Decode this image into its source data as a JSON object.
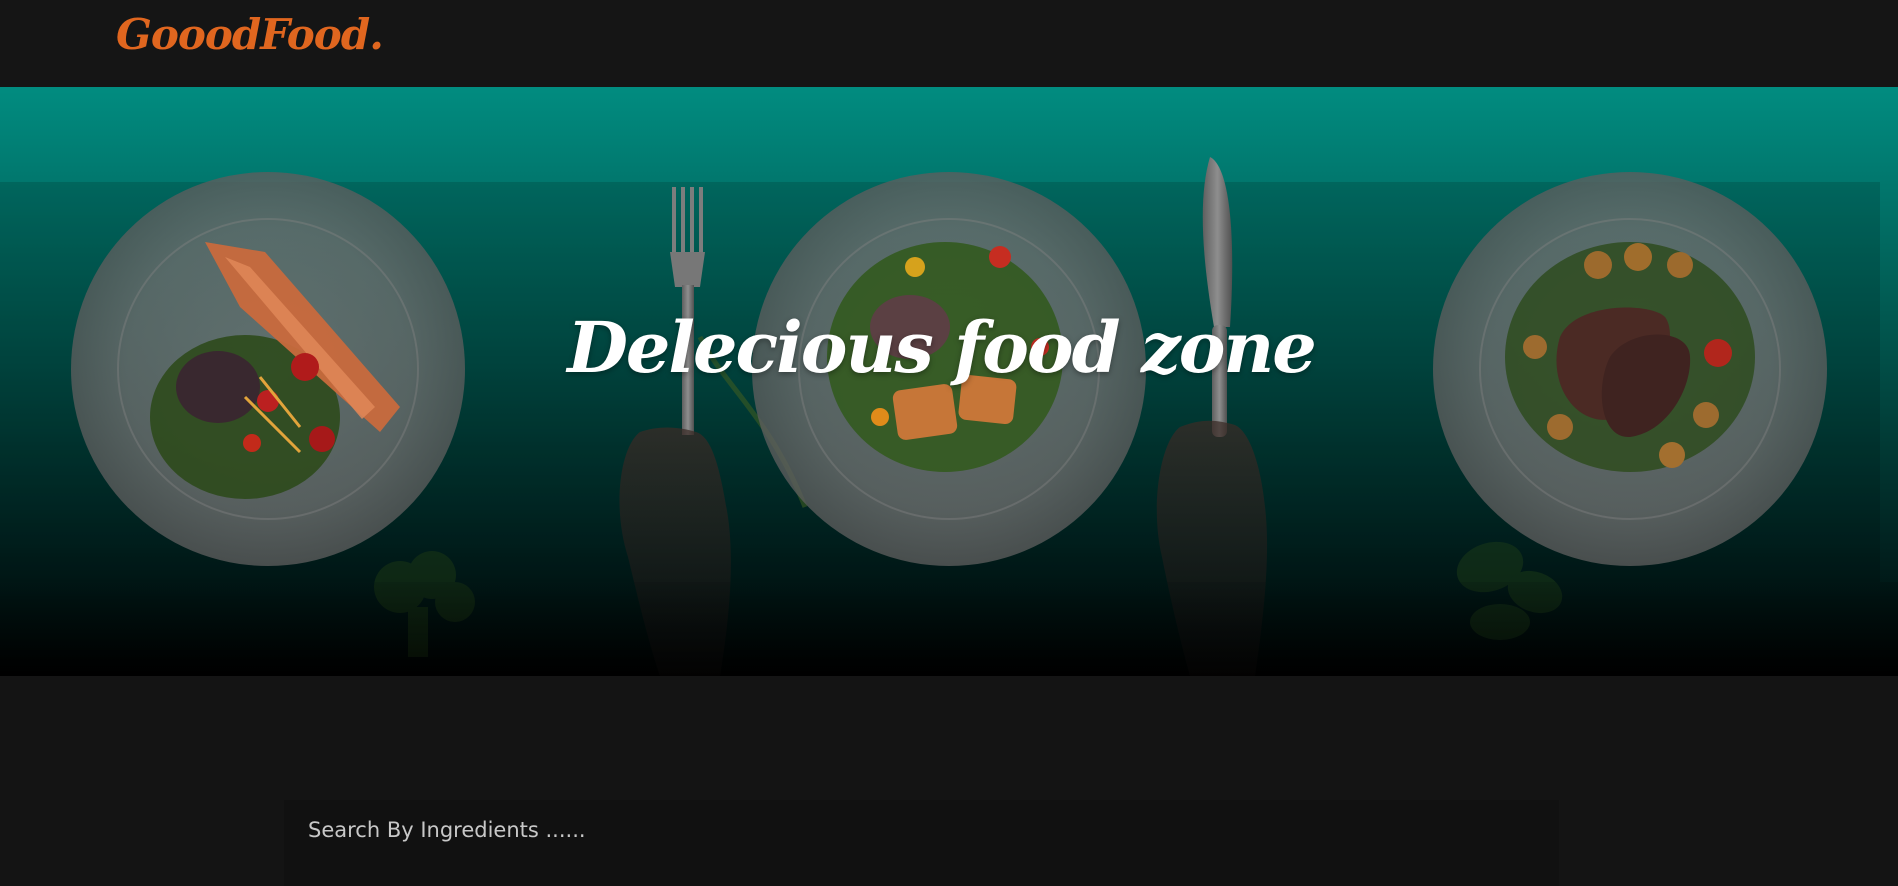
{
  "header": {
    "brand": "GooodFood."
  },
  "hero": {
    "title": "Delecious food zone",
    "gradient_top": "#018c80",
    "gradient_bottom": "#000000"
  },
  "search": {
    "placeholder": "Search By Ingredients ......"
  },
  "colors": {
    "brand": "#e0661f",
    "page_background": "#141414",
    "search_background": "#111111"
  }
}
